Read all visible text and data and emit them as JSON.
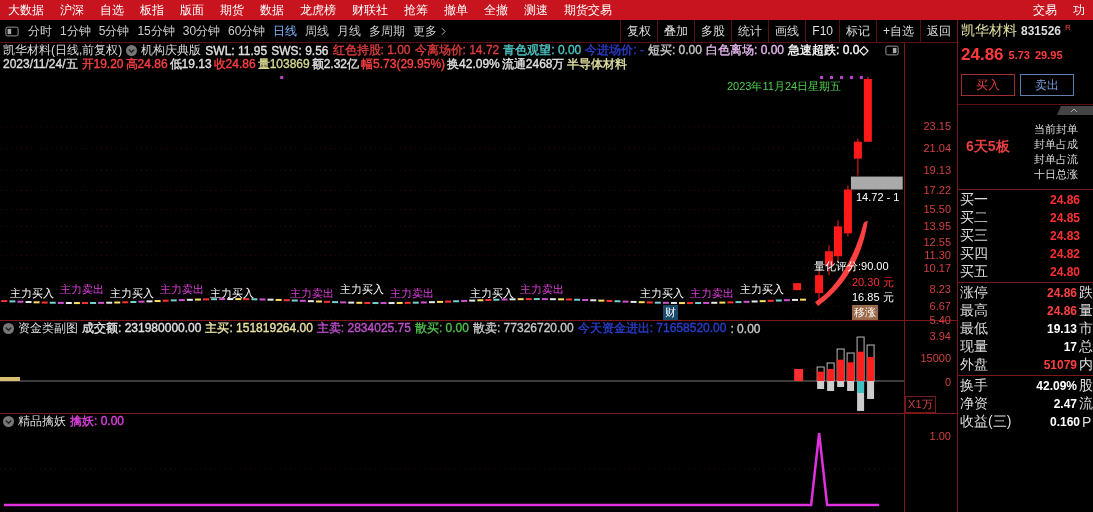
{
  "menu_bar": {
    "items": [
      "大数据",
      "沪深",
      "自选",
      "板指",
      "版面",
      "期货",
      "数据",
      "龙虎榜",
      "财联社",
      "抢筹",
      "撤单",
      "全撤",
      "测速",
      "期货交易"
    ],
    "right_items": [
      "交易",
      "功"
    ]
  },
  "period_tabs": [
    {
      "label": "分时",
      "selected": false
    },
    {
      "label": "1分钟",
      "selected": false
    },
    {
      "label": "5分钟",
      "selected": false
    },
    {
      "label": "15分钟",
      "selected": false
    },
    {
      "label": "30分钟",
      "selected": false
    },
    {
      "label": "60分钟",
      "selected": false
    },
    {
      "label": "日线",
      "selected": true
    },
    {
      "label": "周线",
      "selected": false
    },
    {
      "label": "月线",
      "selected": false
    },
    {
      "label": "多周期",
      "selected": false
    },
    {
      "label": "更多",
      "selected": false
    }
  ],
  "toolbar_buttons": [
    "复权",
    "叠加",
    "多股",
    "统计",
    "画线",
    "F10",
    "标记",
    "+自选",
    "返回"
  ],
  "main_chart": {
    "title": "凯华材料(日线,前复权)",
    "indicator_name": "机构庆典版",
    "indicators": [
      {
        "label": "SWL:",
        "value": "11.95",
        "color": "#e0e0e0"
      },
      {
        "label": "SWS:",
        "value": "9.56",
        "color": "#e0e0e0"
      },
      {
        "label": "红色持股:",
        "value": "1.00",
        "color": "#e03c3c"
      },
      {
        "label": "今离场价:",
        "value": "14.72",
        "color": "#e03c3c"
      },
      {
        "label": "青色观望:",
        "value": "0.00",
        "color": "#4fc8c8"
      },
      {
        "label": "今进场价:",
        "value": "-",
        "color": "#2a3fd0"
      },
      {
        "label": "短买:",
        "value": "0.00",
        "color": "#c8c8c8"
      },
      {
        "label": "白色离场:",
        "value": "0.00",
        "color": "#e8b8f0"
      },
      {
        "label": "急速超跌:",
        "value": "0.0◇",
        "color": "#ffffff"
      }
    ],
    "date": "2023/11/24/五",
    "quote": [
      {
        "label": "开",
        "value": "19.20",
        "color": "#ff4040"
      },
      {
        "label": "高",
        "value": "24.86",
        "color": "#ff4040"
      },
      {
        "label": "低",
        "value": "19.13",
        "color": "#e0e0e0"
      },
      {
        "label": "收",
        "value": "24.86",
        "color": "#ff4040"
      },
      {
        "label": "量",
        "value": "103869",
        "color": "#d8d890"
      },
      {
        "label": "额",
        "value": "2.32亿",
        "color": "#e0e0e0"
      },
      {
        "label": "幅",
        "value": "5.73(29.95%)",
        "color": "#ff4040"
      },
      {
        "label": "换",
        "value": "42.09%",
        "color": "#e0e0e0"
      },
      {
        "label": "流通",
        "value": "2468万",
        "color": "#e0e0e0"
      }
    ],
    "sector": "半导体材料",
    "date_label": "2023年11月24日星期五",
    "range_label": "14.72 - 1",
    "score_label": "量化评分:90.00",
    "price_labels": [
      "20.30 元",
      "16.85 元"
    ],
    "tags": [
      {
        "text": "财",
        "kind": "news"
      },
      {
        "text": "移涨",
        "kind": "alert"
      }
    ],
    "signals": [
      {
        "text": "主力买入",
        "kind": "buy"
      },
      {
        "text": "主力卖出",
        "kind": "sell"
      },
      {
        "text": "主力买入",
        "kind": "buy"
      },
      {
        "text": "主力卖出",
        "kind": "sell"
      },
      {
        "text": "主力买入",
        "kind": "buy"
      },
      {
        "text": "主力卖出",
        "kind": "sell"
      },
      {
        "text": "主力买入",
        "kind": "buy"
      },
      {
        "text": "主力卖出",
        "kind": "sell"
      },
      {
        "text": "主力买入",
        "kind": "buy"
      },
      {
        "text": "主力卖出",
        "kind": "sell"
      },
      {
        "text": "主力买入",
        "kind": "buy"
      },
      {
        "text": "主力卖出",
        "kind": "sell"
      },
      {
        "text": "主力买入",
        "kind": "buy"
      }
    ],
    "axis_labels": [
      "23.15",
      "21.04",
      "19.13",
      "17.22",
      "15.50",
      "13.95",
      "12.55",
      "11.30",
      "10.17",
      "8.23",
      "6.67",
      "5.40",
      "3.94"
    ]
  },
  "fund_chart": {
    "title": "资金类副图",
    "indicators": [
      {
        "label": "成交额:",
        "value": "231980000.00",
        "color": "#e0e0e0"
      },
      {
        "label": "主买:",
        "value": "151819264.00",
        "color": "#e8e0a0"
      },
      {
        "label": "主卖:",
        "value": "2834025.75",
        "color": "#c050d0"
      },
      {
        "label": "散买:",
        "value": "0.00",
        "color": "#50c050"
      },
      {
        "label": "散卖:",
        "value": "77326720.00",
        "color": "#c8c8c8"
      },
      {
        "label": "今天资金进出:",
        "value": "71658520.00",
        "color": "#2a3fd0"
      },
      {
        "label": ":",
        "value": "0.00",
        "color": "#c8c8c8"
      }
    ],
    "axis_labels": [
      "15000",
      "0"
    ],
    "unit": "X1万"
  },
  "demon_chart": {
    "title": "精品擒妖",
    "indicators": [
      {
        "label": "擒妖:",
        "value": "0.00",
        "color": "#e040e0"
      }
    ],
    "axis_labels": [
      "1.00"
    ]
  },
  "quote_panel": {
    "name": "凯华材料",
    "code": "831526",
    "badge": "R",
    "price": "24.86",
    "change": "5.73",
    "change_pct": "29.95",
    "buttons": [
      {
        "label": "买入",
        "kind": "buy"
      },
      {
        "label": "卖出",
        "kind": "sell"
      }
    ],
    "board_count": "6天5板",
    "seal_info": [
      "当前封单",
      "封单占成",
      "封单占流",
      "十日总涨"
    ],
    "bids": [
      {
        "label": "买一",
        "price": "24.86"
      },
      {
        "label": "买二",
        "price": "24.85"
      },
      {
        "label": "买三",
        "price": "24.83"
      },
      {
        "label": "买四",
        "price": "24.82"
      },
      {
        "label": "买五",
        "price": "24.80"
      }
    ],
    "stats": [
      {
        "label": "涨停",
        "value": "24.86",
        "next": "跌",
        "color": "#ff4040"
      },
      {
        "label": "最高",
        "value": "24.86",
        "next": "量",
        "color": "#ff4040"
      },
      {
        "label": "最低",
        "value": "19.13",
        "next": "市",
        "color": "#ffffff"
      },
      {
        "label": "现量",
        "value": "17",
        "next": "总",
        "color": "#ffffff"
      },
      {
        "label": "外盘",
        "value": "51079",
        "next": "内",
        "color": "#ff4040"
      }
    ],
    "finance": [
      {
        "label": "换手",
        "value": "42.09%",
        "next": "股"
      },
      {
        "label": "净资",
        "value": "2.47",
        "next": "流"
      },
      {
        "label": "收益(三)",
        "value": "0.160",
        "next": "P"
      }
    ]
  }
}
